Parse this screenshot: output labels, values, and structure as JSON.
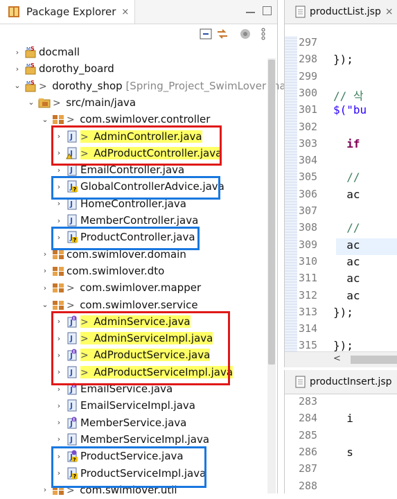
{
  "package_explorer": {
    "title": "Package Explorer",
    "close_glyph": "×",
    "tree": [
      {
        "label": "docmall",
        "indent": 0,
        "chevron": "›",
        "icon": "project-icon"
      },
      {
        "label": "dorothy_board",
        "indent": 0,
        "chevron": "›",
        "icon": "project-icon"
      },
      {
        "label": "dorothy_shop",
        "prefix": ">",
        "extra": " [Spring_Project_SwimLover ma",
        "indent": 0,
        "chevron": "⌄",
        "icon": "project-icon"
      },
      {
        "label": "src/main/java",
        "prefix": ">",
        "indent": 1,
        "chevron": "⌄",
        "icon": "source-folder-icon"
      },
      {
        "label": "com.swimlover.controller",
        "prefix": ">",
        "indent": 2,
        "chevron": "⌄",
        "icon": "package-icon"
      },
      {
        "label": "AdminController.java",
        "prefix": ">",
        "highlight": true,
        "indent": 3,
        "chevron": "›",
        "icon": "java-file-icon"
      },
      {
        "label": "AdProductController.java",
        "prefix": ">",
        "highlight": true,
        "indent": 3,
        "chevron": "›",
        "icon": "java-file-warning-icon"
      },
      {
        "label": "EmailController.java",
        "indent": 3,
        "chevron": "›",
        "icon": "java-file-icon"
      },
      {
        "label": "GlobalControllerAdvice.java",
        "indent": 3,
        "chevron": "›",
        "icon": "java-file-unknown-icon"
      },
      {
        "label": "HomeController.java",
        "indent": 3,
        "chevron": "›",
        "icon": "java-file-icon"
      },
      {
        "label": "MemberController.java",
        "indent": 3,
        "chevron": "›",
        "icon": "java-file-icon"
      },
      {
        "label": "ProductController.java",
        "indent": 3,
        "chevron": "›",
        "icon": "java-file-unknown-icon"
      },
      {
        "label": "com.swimlover.domain",
        "indent": 2,
        "chevron": "›",
        "icon": "package-icon"
      },
      {
        "label": "com.swimlover.dto",
        "indent": 2,
        "chevron": "›",
        "icon": "package-icon"
      },
      {
        "label": "com.swimlover.mapper",
        "prefix": ">",
        "indent": 2,
        "chevron": "›",
        "icon": "package-icon"
      },
      {
        "label": "com.swimlover.service",
        "prefix": ">",
        "indent": 2,
        "chevron": "⌄",
        "icon": "package-icon"
      },
      {
        "label": "AdminService.java",
        "prefix": ">",
        "highlight": true,
        "indent": 3,
        "chevron": "›",
        "icon": "java-interface-icon"
      },
      {
        "label": "AdminServiceImpl.java",
        "prefix": ">",
        "highlight": true,
        "indent": 3,
        "chevron": "›",
        "icon": "java-file-icon"
      },
      {
        "label": "AdProductService.java",
        "prefix": ">",
        "highlight": true,
        "indent": 3,
        "chevron": "›",
        "icon": "java-interface-icon"
      },
      {
        "label": "AdProductServiceImpl.java",
        "prefix": ">",
        "highlight": true,
        "indent": 3,
        "chevron": "›",
        "icon": "java-file-icon"
      },
      {
        "label": "EmailService.java",
        "indent": 3,
        "chevron": "›",
        "icon": "java-interface-icon"
      },
      {
        "label": "EmailServiceImpl.java",
        "indent": 3,
        "chevron": "›",
        "icon": "java-file-icon"
      },
      {
        "label": "MemberService.java",
        "indent": 3,
        "chevron": "›",
        "icon": "java-interface-icon"
      },
      {
        "label": "MemberServiceImpl.java",
        "indent": 3,
        "chevron": "›",
        "icon": "java-file-icon"
      },
      {
        "label": "ProductService.java",
        "indent": 3,
        "chevron": "›",
        "icon": "java-interface-unknown-icon"
      },
      {
        "label": "ProductServiceImpl.java",
        "indent": 3,
        "chevron": "›",
        "icon": "java-file-unknown-icon"
      },
      {
        "label": "com.swimlover.util",
        "prefix": ">",
        "indent": 2,
        "chevron": "›",
        "icon": "package-icon"
      }
    ]
  },
  "editor_top": {
    "tab_label": "productList.jsp",
    "tab_close": "×",
    "lines": [
      {
        "num": "297",
        "code": ""
      },
      {
        "num": "298",
        "code": "});"
      },
      {
        "num": "299",
        "code": ""
      },
      {
        "num": "300",
        "code": "// 삭",
        "style": "cmt"
      },
      {
        "num": "301",
        "code": "$(\"bu",
        "style": "str"
      },
      {
        "num": "302",
        "code": ""
      },
      {
        "num": "303",
        "code": "  if",
        "style": "kw"
      },
      {
        "num": "304",
        "code": ""
      },
      {
        "num": "305",
        "code": "  //",
        "style": "cmt"
      },
      {
        "num": "306",
        "code": "  ac"
      },
      {
        "num": "307",
        "code": ""
      },
      {
        "num": "308",
        "code": "  //",
        "style": "cmt"
      },
      {
        "num": "309",
        "code": "  ac",
        "current": true
      },
      {
        "num": "310",
        "code": "  ac"
      },
      {
        "num": "311",
        "code": "  ac"
      },
      {
        "num": "312",
        "code": "  ac"
      },
      {
        "num": "313",
        "code": "});"
      },
      {
        "num": "314",
        "code": ""
      },
      {
        "num": "315",
        "code": "});"
      }
    ],
    "scroll_arrow": "<"
  },
  "editor_bottom": {
    "tab_label": "productInsert.jsp",
    "lines": [
      {
        "num": "283",
        "code": ""
      },
      {
        "num": "284",
        "code": "  i"
      },
      {
        "num": "285",
        "code": ""
      },
      {
        "num": "286",
        "code": "  s"
      },
      {
        "num": "287",
        "code": ""
      },
      {
        "num": "288",
        "code": ""
      }
    ]
  },
  "colors": {
    "red_box": "#e01818",
    "blue_box": "#1a78e0",
    "highlight": "#ffff66"
  }
}
